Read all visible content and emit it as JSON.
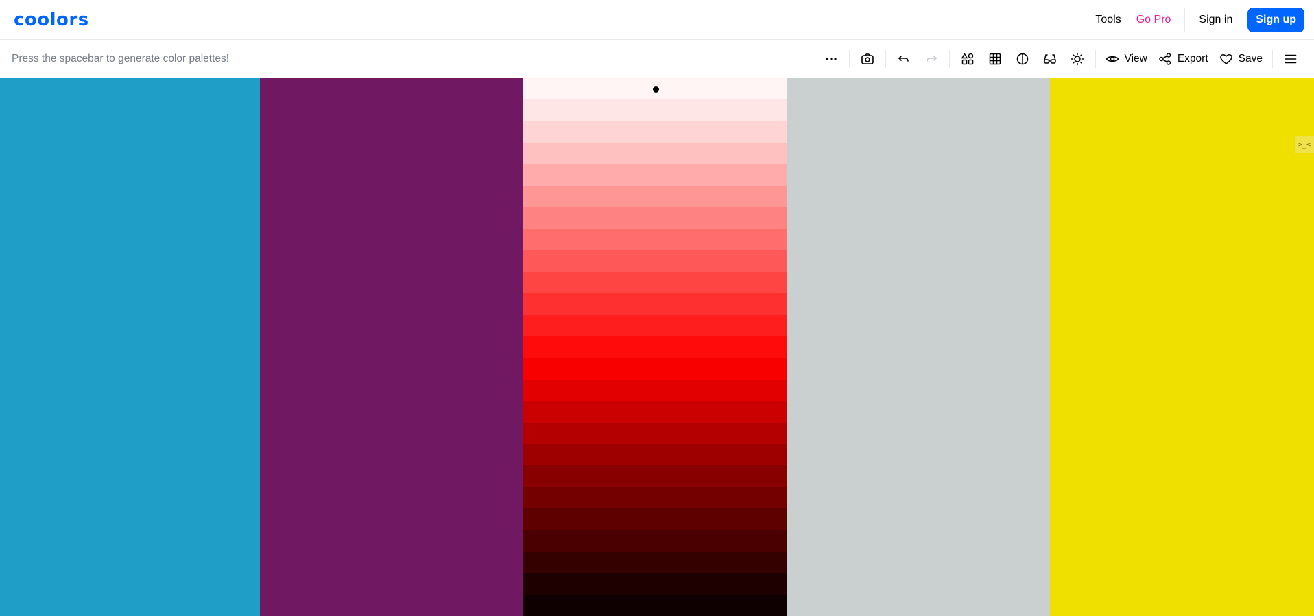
{
  "header": {
    "logo": "coolors",
    "links": {
      "tools": "Tools",
      "go_pro": "Go Pro",
      "sign_in": "Sign in",
      "sign_up": "Sign up"
    }
  },
  "toolbar": {
    "hint": "Press the spacebar to generate color palettes!",
    "view_label": "View",
    "export_label": "Export",
    "save_label": "Save",
    "icons": [
      "more-icon",
      "camera-icon",
      "undo-icon",
      "redo-icon",
      "shapes-icon",
      "grid-icon",
      "contrast-icon",
      "glasses-icon",
      "sun-icon",
      "eye-icon",
      "share-icon",
      "heart-icon",
      "hamburger-menu-icon"
    ]
  },
  "palette": {
    "colors": [
      "#1f9fc7",
      "#711863",
      "shades",
      "#cad0cf",
      "#efe000"
    ],
    "shades": [
      "#fff5f5",
      "#ffe6e6",
      "#ffd4d4",
      "#ffc0c0",
      "#ffabab",
      "#ff9696",
      "#ff8282",
      "#ff6d6d",
      "#ff5858",
      "#ff4444",
      "#ff3030",
      "#ff1e1e",
      "#ff0b0b",
      "#f80000",
      "#e20000",
      "#cb0000",
      "#b40000",
      "#9e0000",
      "#890000",
      "#740000",
      "#5f0000",
      "#4a0000",
      "#340000",
      "#1f0000",
      "#0e0000"
    ],
    "selected_shade_index": 0
  },
  "side_tab": {
    "text": ">_<"
  },
  "colors": {
    "brand": "#0066ff",
    "pro": "#ee1b8e"
  }
}
